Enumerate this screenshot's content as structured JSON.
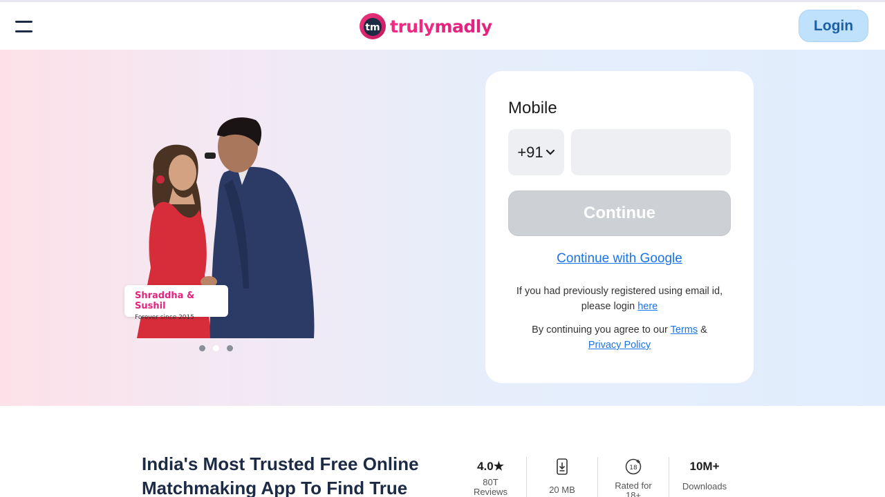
{
  "brand": {
    "name": "trulymadly",
    "name_part1": "truly",
    "name_part2": "madly",
    "logo_initials": "tm",
    "color": "#e2247f"
  },
  "header": {
    "login_label": "Login"
  },
  "hero": {
    "caption_names": "Shraddha & Sushil",
    "caption_since": "Forever since 2015",
    "carousel": {
      "count": 3,
      "active": 2
    }
  },
  "form": {
    "mobile_label": "Mobile",
    "country_code": "+91",
    "phone_value": "",
    "continue_label": "Continue",
    "google_label": "Continue with Google",
    "email_note": "If you had previously registered using email id, please login",
    "email_link": "here",
    "terms_prefix": "By continuing you agree to our",
    "terms_link": "Terms",
    "terms_amp": "&",
    "privacy_link": "Privacy Policy"
  },
  "bottom": {
    "headline": "India's Most Trusted Free Online Matchmaking App To Find True",
    "stats": [
      {
        "value": "4.0★",
        "label": "80T Reviews",
        "icon": "star-icon"
      },
      {
        "value": "",
        "label": "20 MB",
        "icon": "download-phone-icon"
      },
      {
        "value": "",
        "label": "Rated for 18+",
        "icon": "age-18-icon"
      },
      {
        "value": "10M+",
        "label": "Downloads",
        "icon": ""
      }
    ]
  },
  "colors": {
    "login_bg": "#bfe1fb",
    "link": "#1a73e8",
    "continue_disabled": "#cdd0d5",
    "headline": "#1c2a44"
  }
}
